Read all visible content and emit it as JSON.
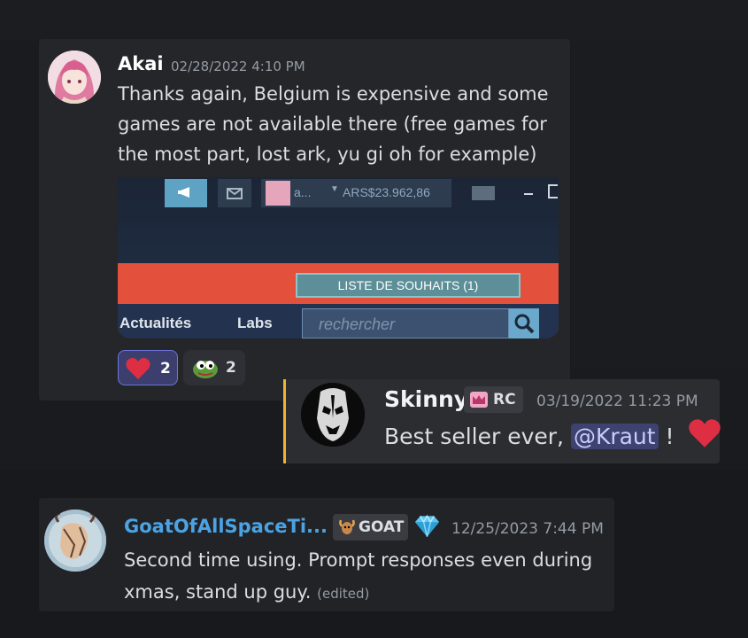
{
  "messages": [
    {
      "author": "Akai",
      "timestamp": "02/28/2022 4:10 PM",
      "text": "Thanks again, Belgium is expensive and some games are not available there (free games for the most part, lost ark, yu gi oh for example)",
      "author_color": "#ffffff",
      "avatar_icon": "pink-hair-anime-avatar",
      "embed": {
        "account_label": "a...",
        "balance": "ARS$23.962,86",
        "wishlist_button": "LISTE DE SOUHAITS (1)",
        "nav_news": "Actualités",
        "nav_labs": "Labs",
        "search_placeholder": "rechercher"
      },
      "reactions": [
        {
          "emoji": "heart",
          "count": "2",
          "active": true
        },
        {
          "emoji": "pepe",
          "count": "2",
          "active": false
        }
      ]
    },
    {
      "author": "Skinny",
      "role_tag": "RC",
      "timestamp": "03/19/2022 11:23 PM",
      "text_before": "Best seller ever, ",
      "mention": "@Kraut",
      "text_after": " !",
      "highlight_color": "#f0b232",
      "avatar_icon": "black-white-face-avatar"
    },
    {
      "author": "GoatOfAllSpaceTi...",
      "role_tag": "GOAT",
      "badge_icon": "diamond-icon",
      "timestamp": "12/25/2023 7:44 PM",
      "text": "Second time using. Prompt responses even during xmas, stand up guy.",
      "edited": "(edited)",
      "author_color": "#4ba3e3",
      "avatar_icon": "goat-sketch-avatar"
    }
  ]
}
